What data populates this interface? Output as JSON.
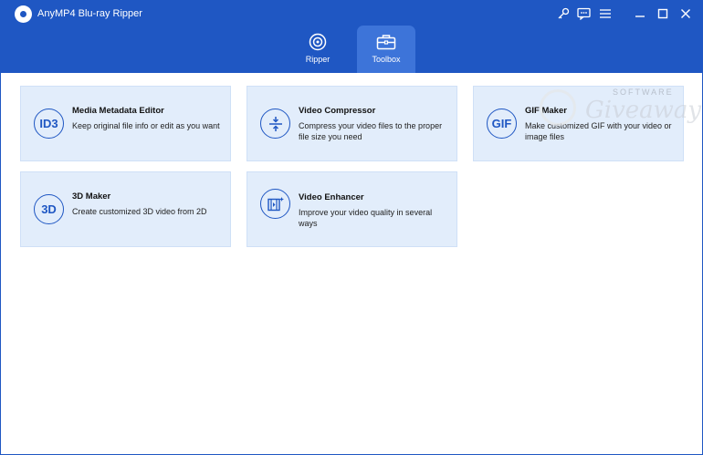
{
  "app": {
    "title": "AnyMP4 Blu-ray Ripper"
  },
  "titlebar": {
    "buttons": [
      {
        "name": "key-icon"
      },
      {
        "name": "feedback-icon"
      },
      {
        "name": "menu-icon"
      },
      {
        "name": "minimize-icon"
      },
      {
        "name": "maximize-icon"
      },
      {
        "name": "close-icon"
      }
    ]
  },
  "tabs": [
    {
      "label": "Ripper",
      "icon": "disc-icon",
      "active": false
    },
    {
      "label": "Toolbox",
      "icon": "toolbox-icon",
      "active": true
    }
  ],
  "tools": [
    {
      "icon_text": "ID3",
      "title": "Media Metadata Editor",
      "desc": "Keep original file info or edit as you want"
    },
    {
      "icon": "compress-icon",
      "title": "Video Compressor",
      "desc": "Compress your video files to the proper file size you need"
    },
    {
      "icon_text": "GIF",
      "title": "GIF Maker",
      "desc": "Make customized GIF with your video or image files"
    },
    {
      "icon_text": "3D",
      "title": "3D Maker",
      "desc": "Create customized 3D video from 2D"
    },
    {
      "icon": "enhance-icon",
      "title": "Video Enhancer",
      "desc": "Improve your video quality in several ways"
    }
  ],
  "watermark": {
    "line1": "SOFTWARE",
    "line2": "Giveaway"
  },
  "colors": {
    "brand": "#1f57c3",
    "tab_active": "#3d74d9",
    "card_bg": "#e2edfb"
  }
}
